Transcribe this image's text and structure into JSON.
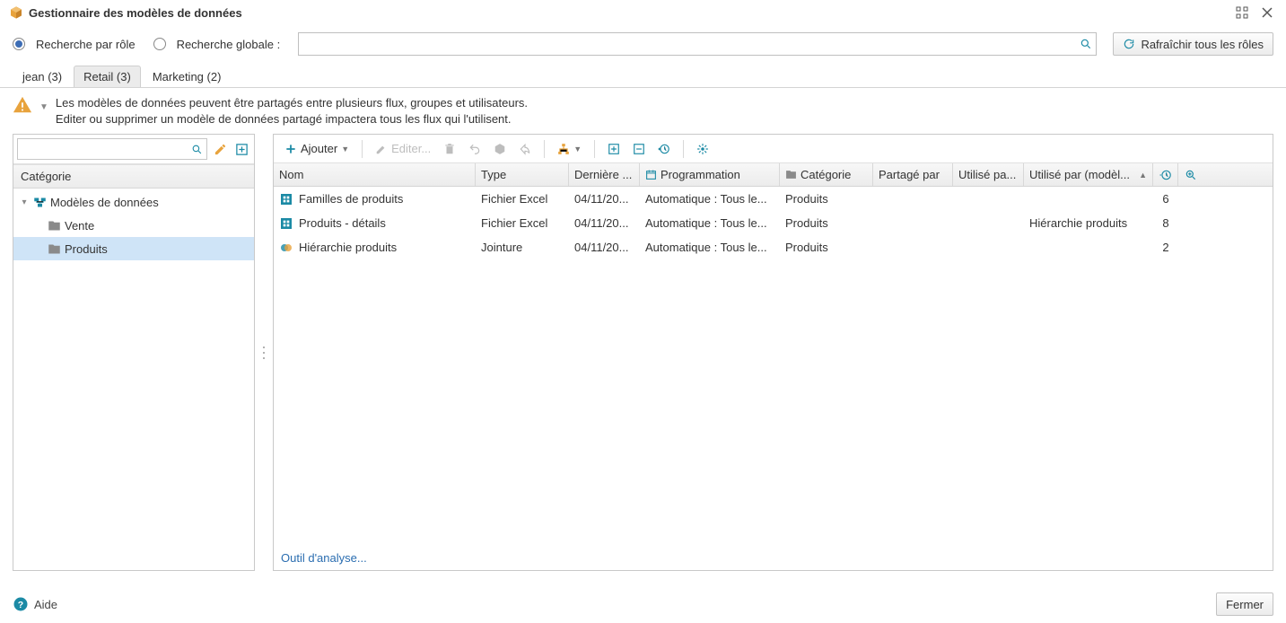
{
  "title": "Gestionnaire des modèles de données",
  "search": {
    "mode_role": "Recherche par rôle",
    "mode_global": "Recherche globale :",
    "value": "",
    "refresh_btn": "Rafraîchir tous les rôles"
  },
  "tabs": [
    {
      "label": "jean (3)",
      "active": false
    },
    {
      "label": "Retail (3)",
      "active": true
    },
    {
      "label": "Marketing (2)",
      "active": false
    }
  ],
  "warning": {
    "line1": "Les modèles de données peuvent être partagés entre plusieurs flux, groupes et utilisateurs.",
    "line2": "Editer ou supprimer un modèle de données partagé impactera tous les flux qui l'utilisent."
  },
  "sidebar": {
    "search_value": "",
    "header": "Catégorie",
    "tree": {
      "root": "Modèles de données",
      "children": [
        {
          "label": "Vente",
          "selected": false
        },
        {
          "label": "Produits",
          "selected": true
        }
      ]
    }
  },
  "toolbar": {
    "add": "Ajouter",
    "edit": "Editer..."
  },
  "grid": {
    "columns": {
      "nom": "Nom",
      "type": "Type",
      "date": "Dernière ...",
      "prog": "Programmation",
      "cat": "Catégorie",
      "part": "Partagé par",
      "util": "Utilisé pa...",
      "model": "Utilisé par (modèl..."
    },
    "rows": [
      {
        "nom": "Familles de produits",
        "type": "Fichier Excel",
        "date": "04/11/20...",
        "prog": "Automatique : Tous le...",
        "cat": "Produits",
        "part": "",
        "util": "",
        "model": "",
        "count": "6",
        "icon": "excel"
      },
      {
        "nom": "Produits - détails",
        "type": "Fichier Excel",
        "date": "04/11/20...",
        "prog": "Automatique : Tous le...",
        "cat": "Produits",
        "part": "",
        "util": "",
        "model": "Hiérarchie produits",
        "count": "8",
        "icon": "excel"
      },
      {
        "nom": "Hiérarchie produits",
        "type": "Jointure",
        "date": "04/11/20...",
        "prog": "Automatique : Tous le...",
        "cat": "Produits",
        "part": "",
        "util": "",
        "model": "",
        "count": "2",
        "icon": "join"
      }
    ]
  },
  "footer_link": "Outil d'analyse...",
  "help_label": "Aide",
  "close_btn": "Fermer"
}
